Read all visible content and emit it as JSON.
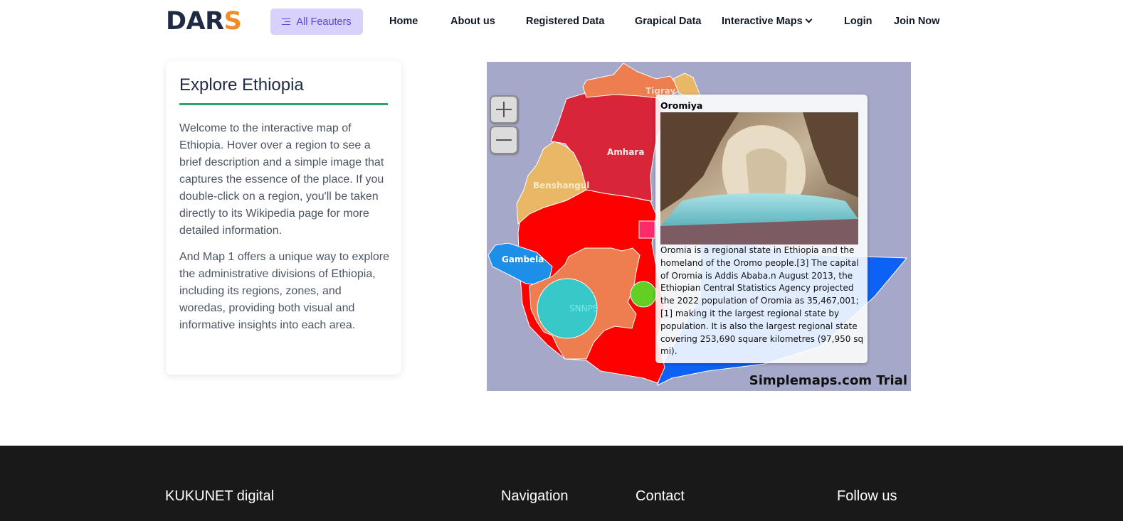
{
  "brand": {
    "prefix": "DAR",
    "accent": "S",
    "accent_color": "#f28c28"
  },
  "nav": {
    "features": {
      "label": "All Feauters",
      "icon": "menu-icon"
    },
    "links": [
      "Home",
      "About us",
      "Registered Data",
      "Grapical Data",
      "Interactive Maps",
      "Login",
      "Join Now"
    ]
  },
  "explore": {
    "title": "Explore Ethiopia",
    "paragraph1": "Welcome to the interactive map of Ethiopia. Hover over a region to see a brief description and a simple image that captures the essence of the place. If you double-click on a region, you'll be taken directly to its Wikipedia page for more detailed information.",
    "paragraph2": "And Map 1 offers a unique way to explore the administrative divisions of Ethiopia, including its regions, zones, and woredas, providing both visual and informative insights into each area."
  },
  "map": {
    "regions": {
      "tigray": "Tigray",
      "amhara": "Amhara",
      "benshangul": "Benshangul",
      "gambela": "Gambela",
      "snnps": "SNNPS"
    },
    "watermark": "Simplemaps.com Trial",
    "colors": {
      "background": "#a6a8c9",
      "tigray": "#ee7d4f",
      "amhara": "#d8253a",
      "benshangul": "#e8b867",
      "oromia": "#ff0000",
      "gambela": "#1d8fe8",
      "snnps": "#ee7d4f",
      "somali": "#0d62f5",
      "marker_large": "#38c8c8",
      "marker_small": "#62cf25"
    },
    "tooltip": {
      "title": "Oromiya",
      "description": "Oromia is a regional state in Ethiopia and the homeland of the Oromo people.[3] The capital of Oromia is Addis Ababa.n August 2013, the Ethiopian Central Statistics Agency projected the 2022 population of Oromia as 35,467,001;[1] making it the largest regional state by population. It is also the largest regional state covering 253,690 square kilometres (97,950 sq mi)."
    }
  },
  "footer": {
    "brand": "KUKUNET digital",
    "navigation": "Navigation",
    "contact": "Contact",
    "follow": "Follow us"
  }
}
